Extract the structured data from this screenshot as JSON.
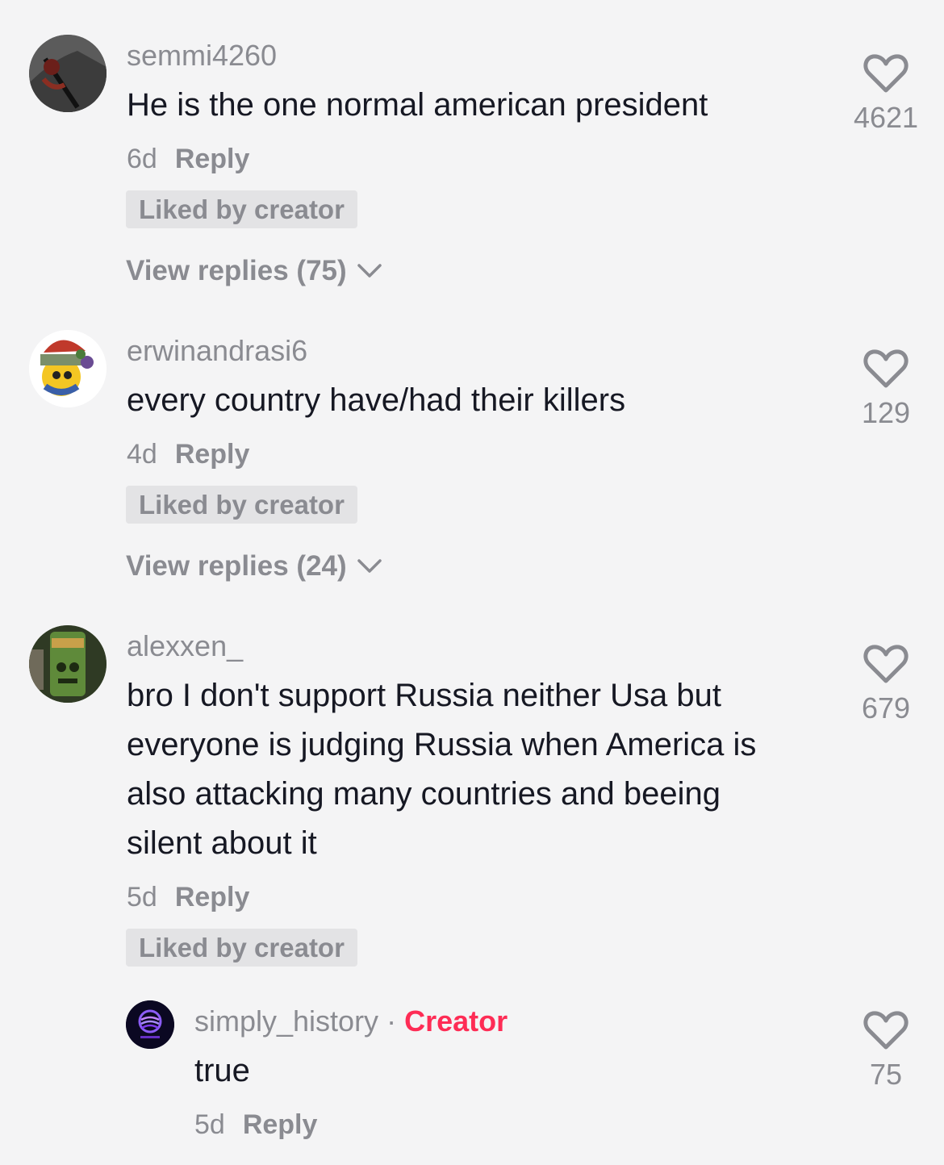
{
  "comments": [
    {
      "username": "semmi4260",
      "text": "He is the one normal american president",
      "time": "6d",
      "reply_label": "Reply",
      "badge": "Liked by creator",
      "view_replies": "View replies (75)",
      "likes": "4621"
    },
    {
      "username": "erwinandrasi6",
      "text": "every country have/had their killers",
      "time": "4d",
      "reply_label": "Reply",
      "badge": "Liked by creator",
      "view_replies": "View replies (24)",
      "likes": "129"
    },
    {
      "username": "alexxen_",
      "text": "bro I don't support Russia neither Usa but everyone is judging Russia when America is also attacking many countries and beeing silent about it",
      "time": "5d",
      "reply_label": "Reply",
      "badge": "Liked by creator",
      "likes": "679"
    }
  ],
  "creator_reply": {
    "username": "simply_history",
    "separator": "·",
    "creator_label": "Creator",
    "text": "true",
    "time": "5d",
    "reply_label": "Reply",
    "likes": "75"
  },
  "colors": {
    "background": "#f4f4f5",
    "primary_text": "#161823",
    "secondary_text": "#8a8b91",
    "creator_accent": "#fe2c55",
    "badge_bg": "#e3e3e5"
  },
  "icons": [
    "heart-icon",
    "chevron-down-icon"
  ]
}
